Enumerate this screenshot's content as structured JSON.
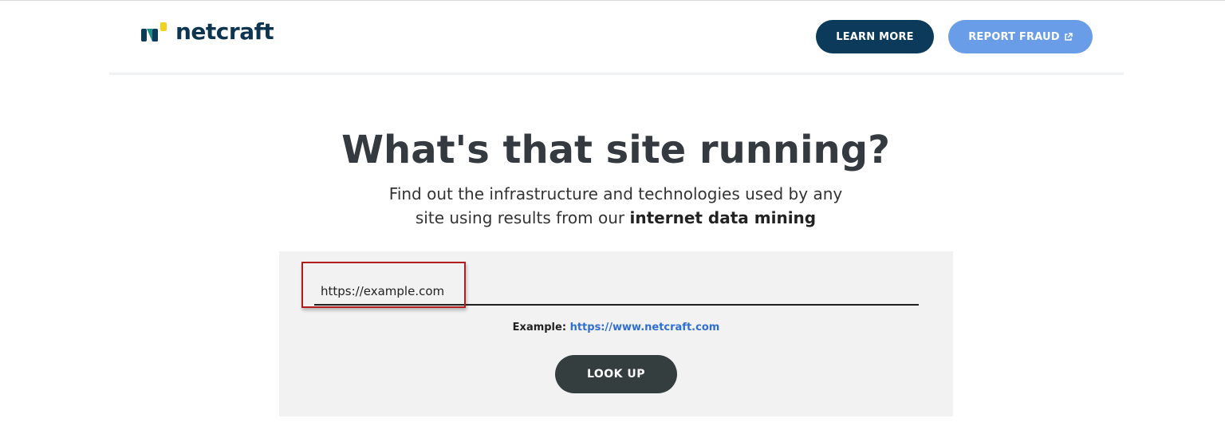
{
  "brand": {
    "name": "netcraft",
    "colors": {
      "navy": "#0b3a5a",
      "yellow": "#f2d21b",
      "teal": "#1c8c8c",
      "light_blue": "#6a9de8",
      "dark_button": "#343e3e"
    }
  },
  "header": {
    "learn_more_label": "LEARN MORE",
    "report_fraud_label": "REPORT FRAUD",
    "report_fraud_icon": "external-link-icon"
  },
  "hero": {
    "title": "What's that site running?",
    "subtitle_line1": "Find out the infrastructure and technologies used by any",
    "subtitle_line2_prefix": "site using results from our ",
    "subtitle_line2_bold": "internet data mining"
  },
  "search": {
    "input_value": "https://example.com",
    "example_label": "Example:",
    "example_link": "https://www.netcraft.com",
    "lookup_label": "LOOK UP"
  }
}
